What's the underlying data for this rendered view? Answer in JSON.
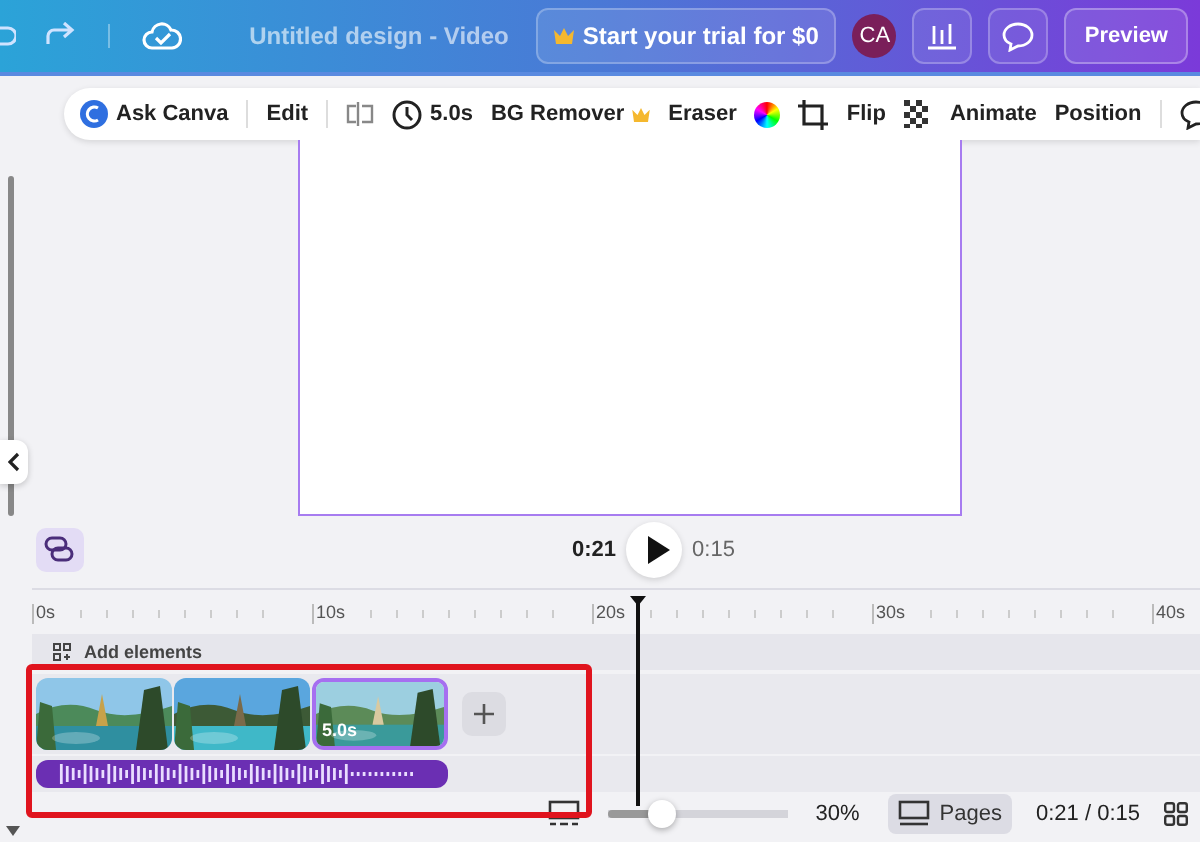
{
  "topbar": {
    "title": "Untitled design - Video",
    "trial_button": "Start your trial for $0",
    "avatar": "CA",
    "preview_button": "Preview"
  },
  "toolbar": {
    "ask_canva": "Ask Canva",
    "edit": "Edit",
    "duration": "5.0s",
    "bg_remover": "BG Remover",
    "eraser": "Eraser",
    "flip": "Flip",
    "animate": "Animate",
    "position": "Position"
  },
  "playback": {
    "current_time": "0:21",
    "total_time": "0:15"
  },
  "timeline": {
    "ruler": [
      "0s",
      "10s",
      "20s",
      "30s",
      "40s"
    ],
    "track_label": "Add elements",
    "clips": [
      {
        "kind": "picture",
        "selected": false
      },
      {
        "kind": "picture",
        "selected": false
      },
      {
        "kind": "picture",
        "selected": true,
        "duration": "5.0s"
      }
    ]
  },
  "bottom_bar": {
    "zoom": {
      "level": 0.3,
      "reading": "30%"
    },
    "pages_button": "Pages",
    "time": "0:21 / 0:15"
  }
}
